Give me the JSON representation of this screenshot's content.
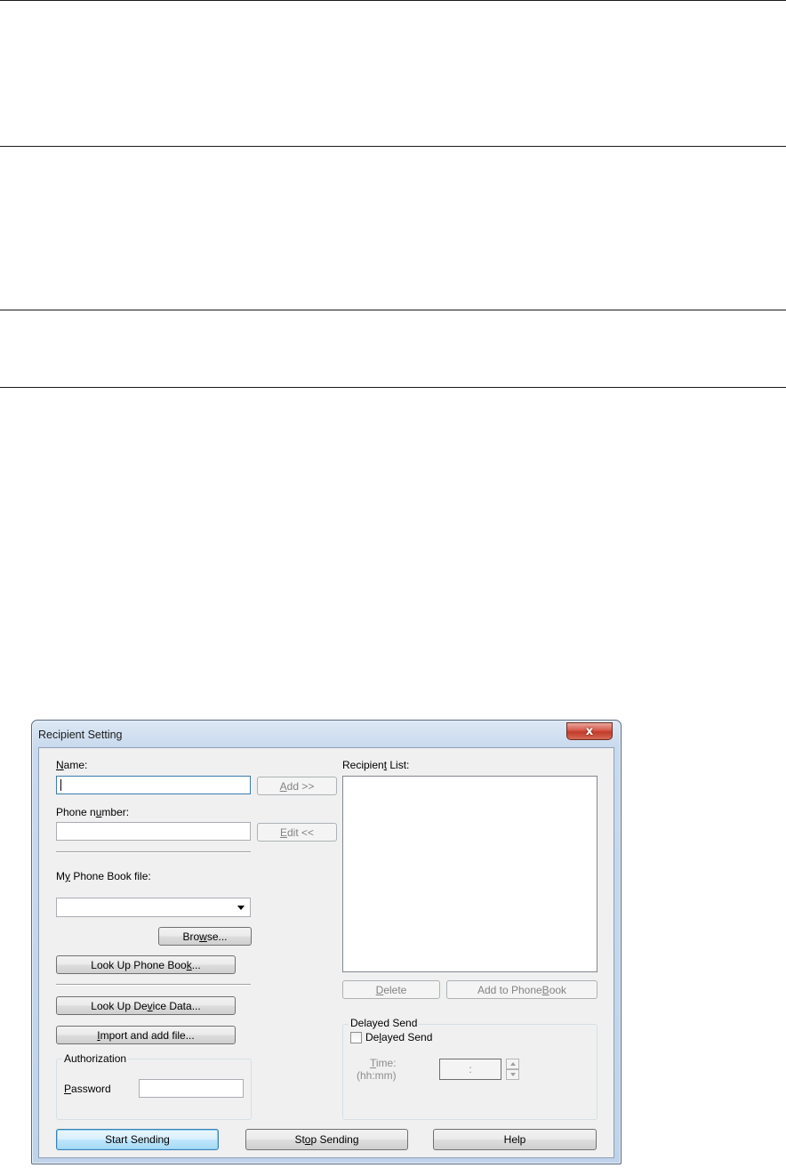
{
  "dialog": {
    "title": "Recipient Setting",
    "close_glyph": "x"
  },
  "form": {
    "name": {
      "pre": "",
      "acc": "N",
      "post": "ame:",
      "value": ""
    },
    "phone": {
      "pre": "Phone n",
      "acc": "u",
      "post": "mber:",
      "value": ""
    },
    "add_button": {
      "pre": "",
      "acc": "A",
      "post": "dd >>"
    },
    "edit_button": {
      "pre": "",
      "acc": "E",
      "post": "dit <<"
    },
    "phone_book_file": {
      "pre": "M",
      "acc": "y",
      "post": " Phone Book file:",
      "value": ""
    },
    "browse_button": {
      "pre": "Bro",
      "acc": "w",
      "post": "se..."
    },
    "lookup_phonebook_button": {
      "pre": "Look Up Phone Boo",
      "acc": "k",
      "post": "..."
    },
    "lookup_device_button": {
      "pre": "Look Up De",
      "acc": "v",
      "post": "ice Data..."
    },
    "import_button": {
      "pre": "",
      "acc": "I",
      "post": "mport and add file..."
    },
    "authorization": {
      "title": "Authorization",
      "password": {
        "pre": "",
        "acc": "P",
        "post": "assword",
        "value": ""
      }
    }
  },
  "recipients": {
    "label": {
      "pre": "Recipien",
      "acc": "t",
      "post": " List:"
    },
    "items": [],
    "delete_button": {
      "pre": "",
      "acc": "D",
      "post": "elete"
    },
    "add_to_phonebook_button": {
      "pre": "Add to Phone ",
      "acc": "B",
      "post": "ook"
    }
  },
  "delayed_send": {
    "group_title": "Delayed Send",
    "checkbox": {
      "pre": "De",
      "acc": "l",
      "post": "ayed Send",
      "checked": false
    },
    "time_label": {
      "pre": "",
      "acc": "T",
      "post": "ime:"
    },
    "time_format": "(hh:mm)",
    "time_value": ":"
  },
  "footer": {
    "start_button": "Start Sending",
    "stop_button": {
      "pre": "St",
      "acc": "o",
      "post": "p Sending"
    },
    "help_button": "Help"
  }
}
